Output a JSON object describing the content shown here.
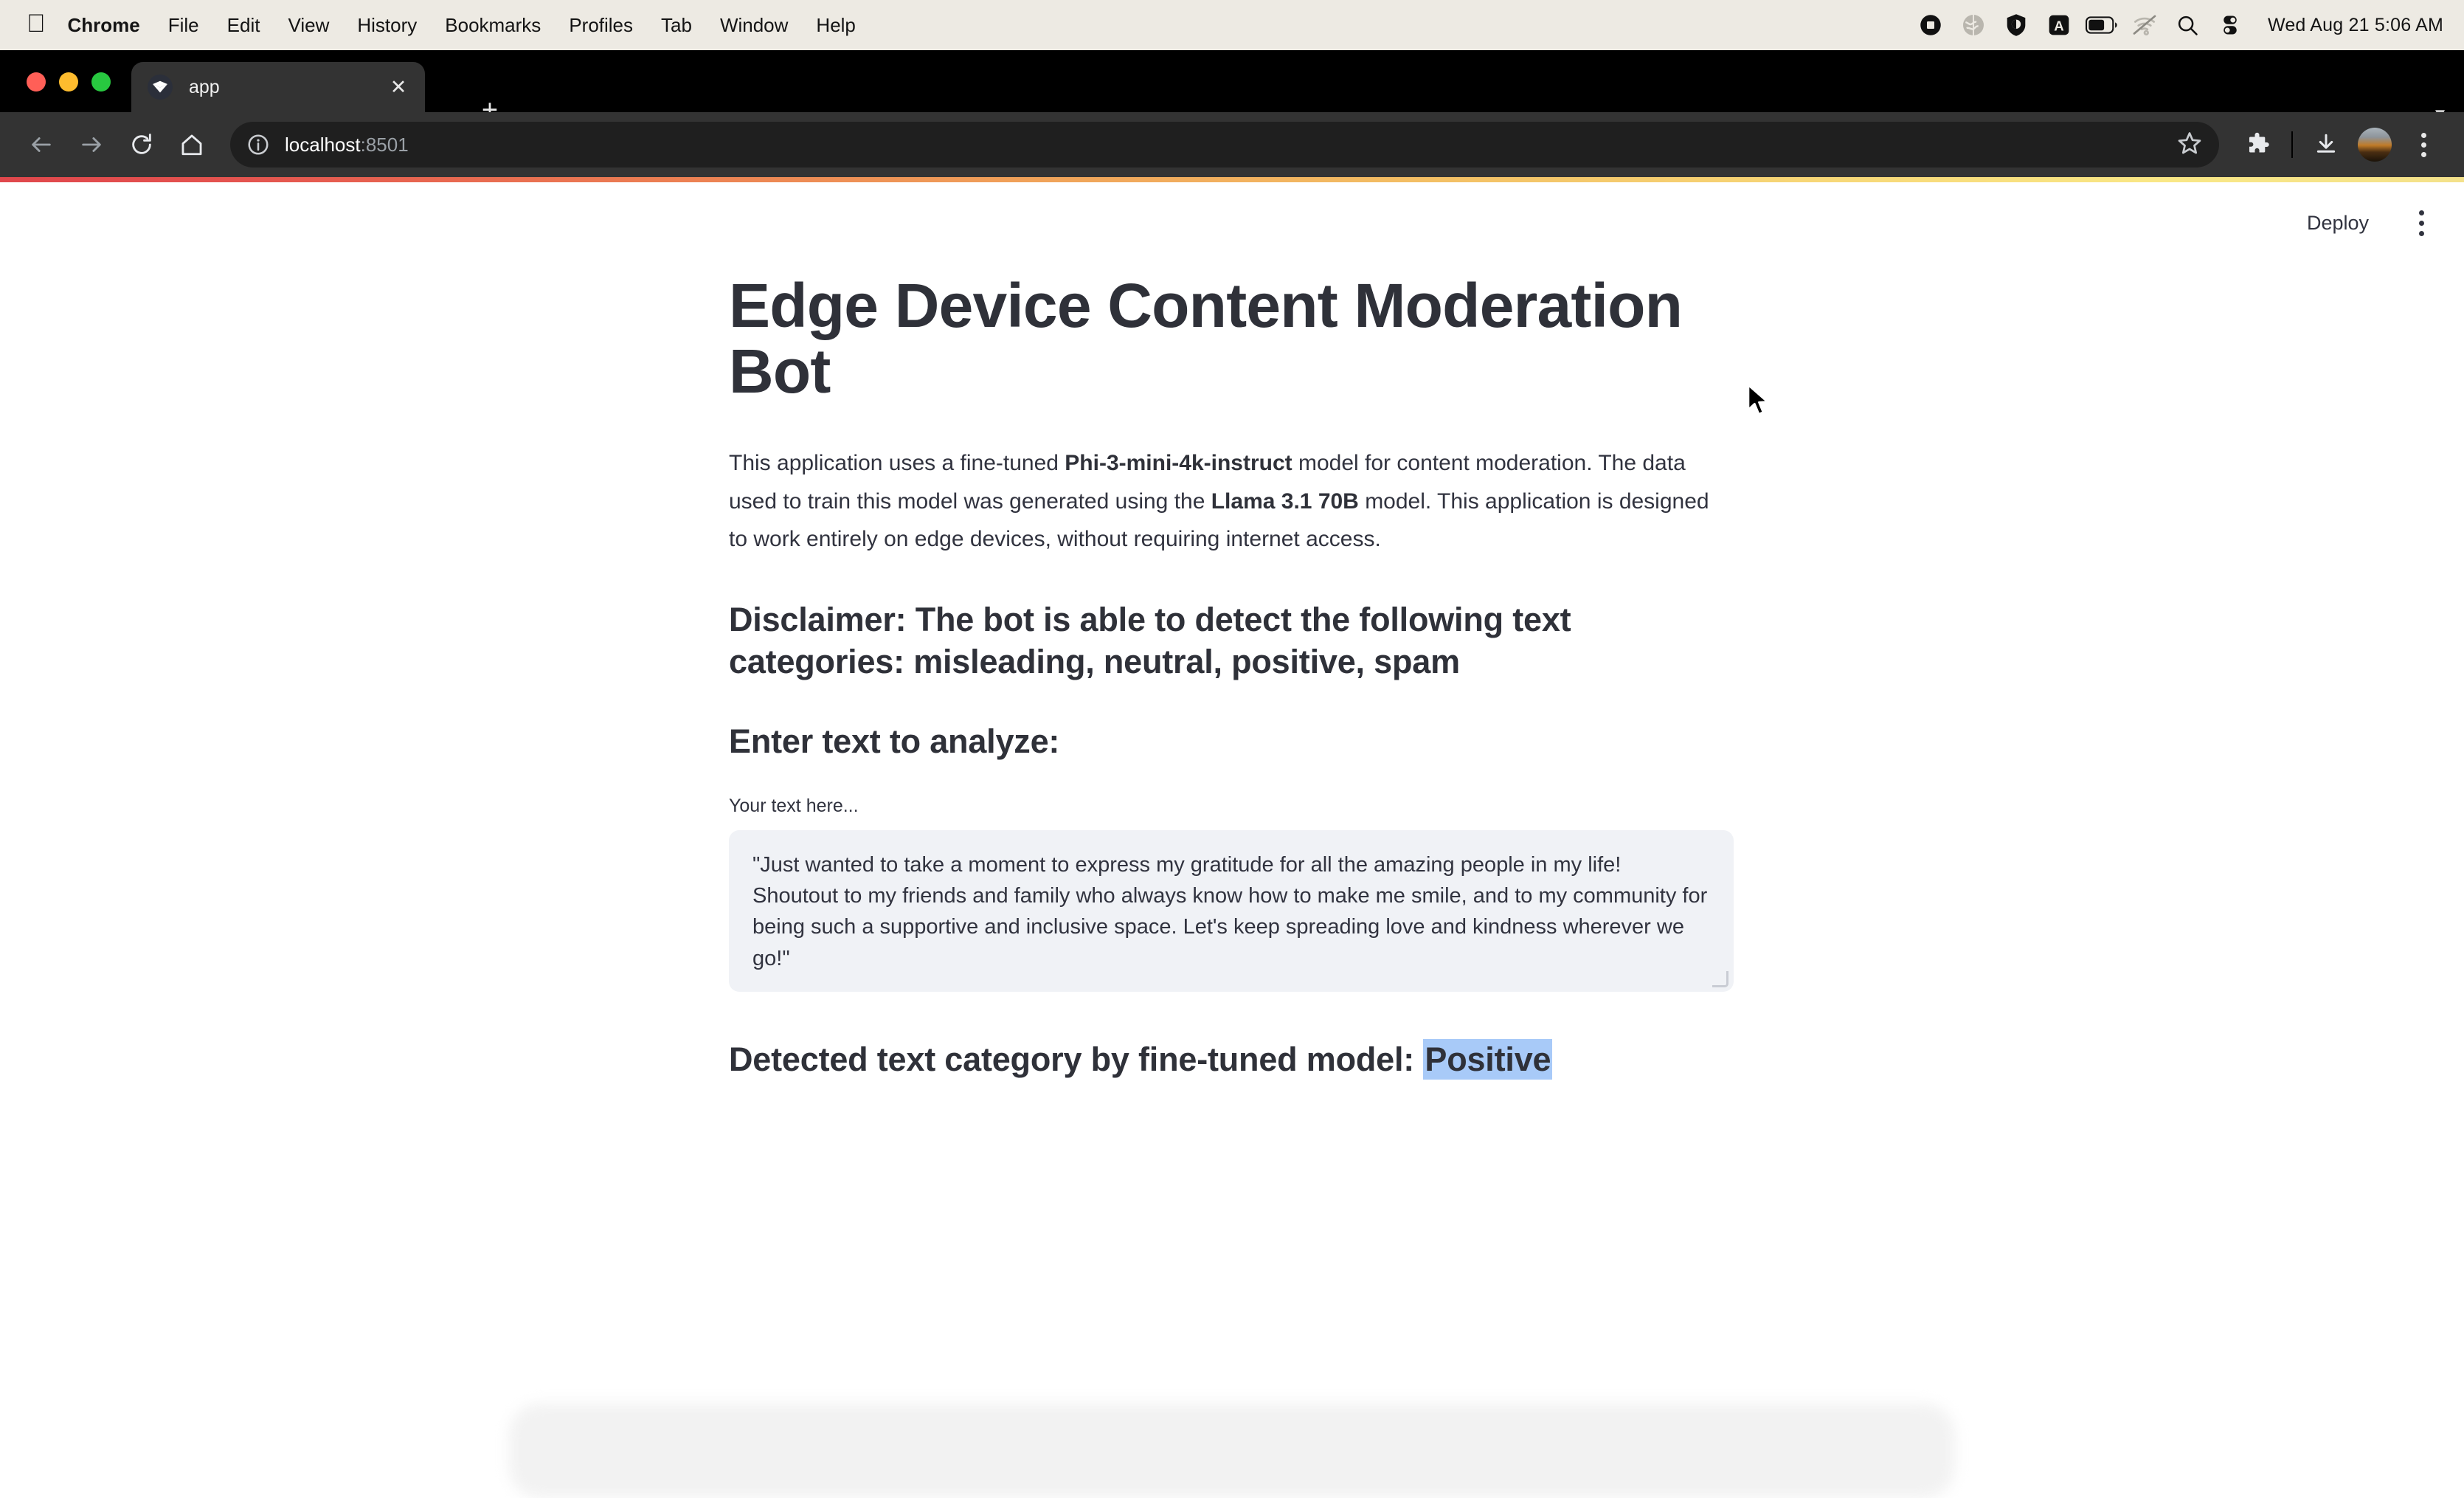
{
  "menubar": {
    "apple_icon": "apple-logo",
    "items": [
      "Chrome",
      "File",
      "Edit",
      "View",
      "History",
      "Bookmarks",
      "Profiles",
      "Tab",
      "Window",
      "Help"
    ],
    "tray_icons": [
      "screen-recording-icon",
      "globe-icon",
      "shield-vpn-icon",
      "input-source-a-icon",
      "battery-icon",
      "wifi-off-icon",
      "spotlight-search-icon",
      "control-center-icon"
    ],
    "clock": "Wed Aug 21  5:06 AM"
  },
  "browser": {
    "tab": {
      "title": "app",
      "favicon": "streamlit-favicon",
      "close_icon": "close-icon"
    },
    "new_tab_icon": "plus-icon",
    "tab_list_icon": "chevron-down-icon",
    "nav": {
      "back_icon": "back-arrow-icon",
      "forward_icon": "forward-arrow-icon",
      "reload_icon": "reload-icon",
      "home_icon": "home-icon"
    },
    "omnibox": {
      "info_icon": "site-info-icon",
      "url_host": "localhost",
      "url_port": ":8501",
      "star_icon": "bookmark-star-icon"
    },
    "toolbar_icons": [
      "extensions-puzzle-icon",
      "downloads-icon",
      "profile-avatar",
      "chrome-menu-kebab-icon"
    ]
  },
  "streamlit": {
    "header": {
      "deploy_label": "Deploy",
      "menu_icon": "app-menu-kebab-icon"
    },
    "title": "Edge Device Content Moderation Bot",
    "description": {
      "part1": "This application uses a fine-tuned ",
      "bold1": "Phi-3-mini-4k-instruct",
      "part2": " model for content moderation. The data used to train this model was generated using the ",
      "bold2": "Llama 3.1 70B",
      "part3": " model. This application is designed to work entirely on edge devices, without requiring internet access."
    },
    "disclaimer": "Disclaimer: The bot is able to detect the following text categories: misleading, neutral, positive, spam",
    "enter_heading": "Enter text to analyze:",
    "textarea": {
      "label": "Your text here...",
      "value": "\"Just wanted to take a moment to express my gratitude for all the amazing people in my life! Shoutout to my friends and family who always know how to make me smile, and to my community for being such a supportive and inclusive space. Let's keep spreading love and kindness wherever we go!\"",
      "placeholder": "Your text here..."
    },
    "result": {
      "prefix": "Detected text category by fine-tuned model: ",
      "category": "Positive"
    },
    "colors": {
      "accent_gradient_start": "#e0474c",
      "accent_gradient_end": "#f9e786",
      "text": "#31333f",
      "widget_bg": "#f0f2f6",
      "highlight": "#a8caf8"
    }
  }
}
